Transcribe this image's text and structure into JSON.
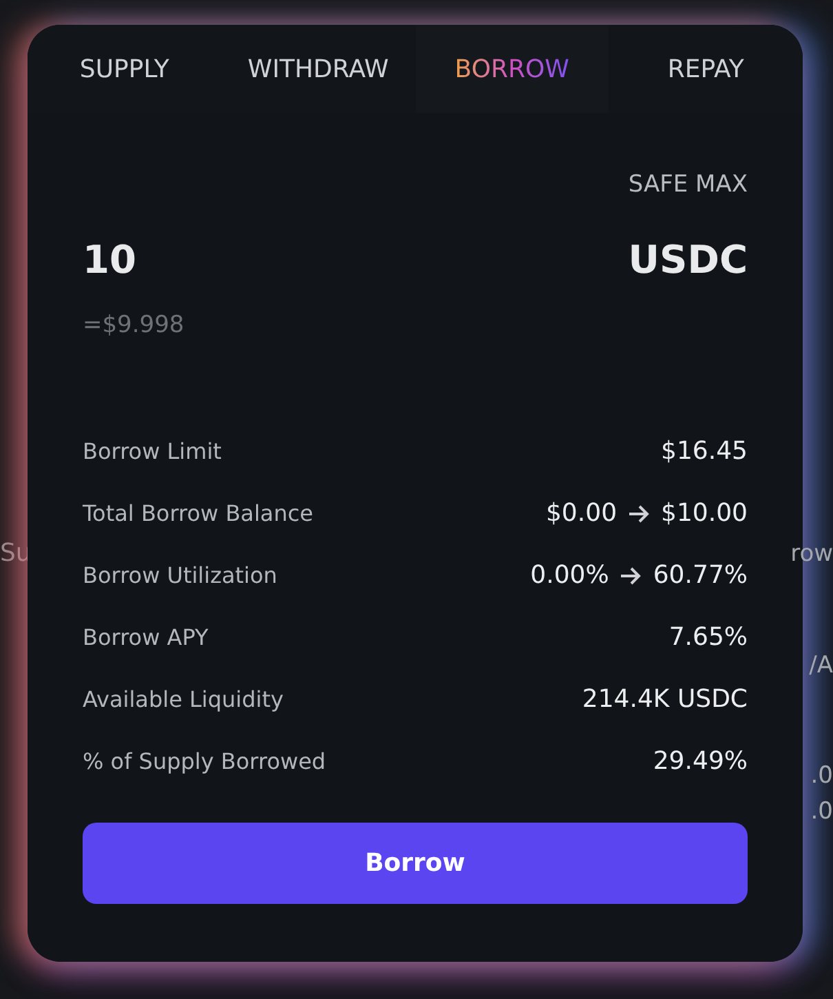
{
  "background": {
    "left_fragments": [
      "Su"
    ],
    "right_fragments": [
      "row",
      "/A",
      ".0",
      ".0"
    ]
  },
  "tabs": [
    {
      "label": "SUPPLY",
      "selected": false
    },
    {
      "label": "WITHDRAW",
      "selected": false
    },
    {
      "label": "BORROW",
      "selected": true
    },
    {
      "label": "REPAY",
      "selected": false
    }
  ],
  "safe_max": "SAFE MAX",
  "amount": {
    "value": "10",
    "token": "USDC",
    "usd": "=$9.998"
  },
  "details": [
    {
      "label": "Borrow Limit",
      "value": "$16.45"
    },
    {
      "label": "Total Borrow Balance",
      "from": "$0.00",
      "to": "$10.00"
    },
    {
      "label": "Borrow Utilization",
      "from": "0.00%",
      "to": "60.77%"
    },
    {
      "label": "Borrow APY",
      "value": "7.65%"
    },
    {
      "label": "Available Liquidity",
      "value": "214.4K USDC"
    },
    {
      "label": "% of Supply Borrowed",
      "value": "29.49%"
    }
  ],
  "button": "Borrow"
}
